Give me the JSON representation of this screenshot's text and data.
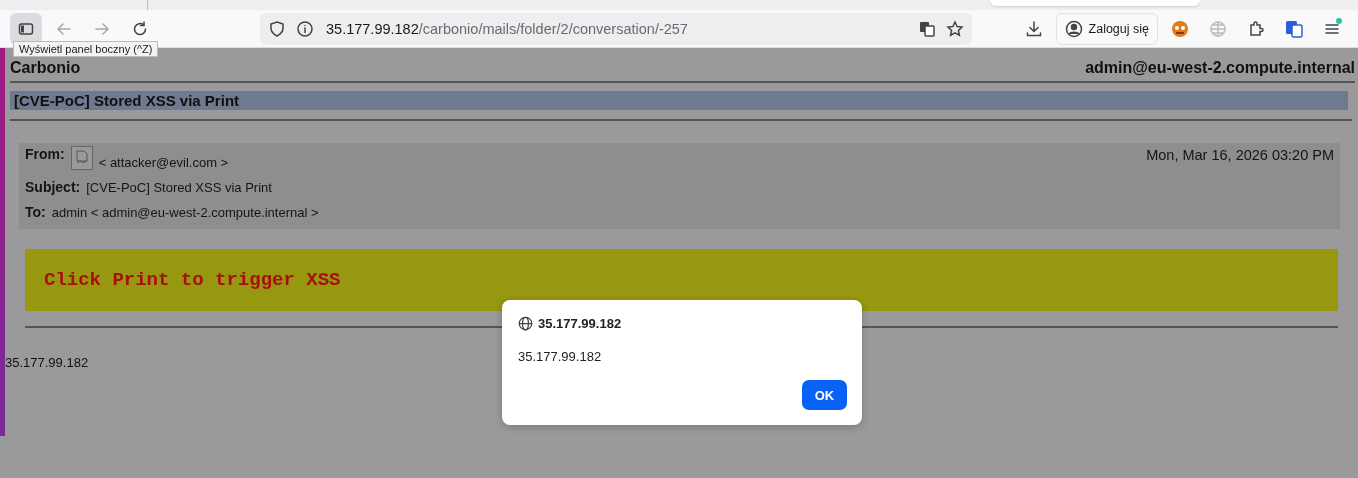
{
  "toolbar": {
    "sidebar_button": {
      "selected": true,
      "tooltip": "Wyświetl panel boczny (^Z)"
    },
    "back_disabled": true,
    "forward_disabled": true
  },
  "address_bar": {
    "host": "35.177.99.182",
    "path": "/carbonio/mails/folder/2/conversation/-257"
  },
  "account_button": "Zaloguj się",
  "page": {
    "app_name": "Carbonio",
    "user": "admin@eu-west-2.compute.internal",
    "subject_title": "[CVE-PoC] Stored XSS via Print",
    "headers": {
      "from_label": "From:",
      "from_value": "< attacker@evil.com >",
      "date": "Mon, Mar 16, 2026 03:20 PM",
      "subject_label": "Subject:",
      "subject_value": "[CVE-PoC] Stored XSS via Print",
      "to_label": "To:",
      "to_value": "admin < admin@eu-west-2.compute.internal >"
    },
    "banner": "Click Print to trigger XSS",
    "footer_text": "35.177.99.182"
  },
  "dialog": {
    "title": "35.177.99.182",
    "message": "35.177.99.182",
    "button": "OK"
  }
}
